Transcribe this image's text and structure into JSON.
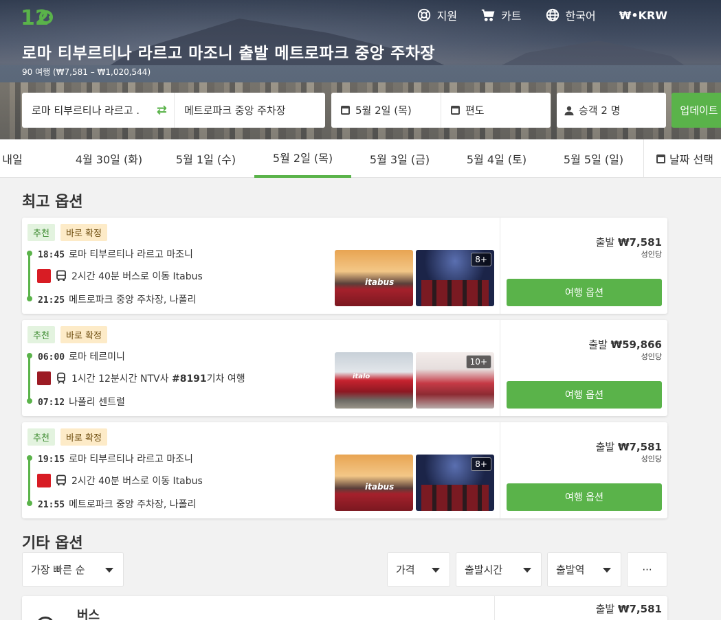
{
  "brand": {
    "logo": "12GO",
    "accent": "#5ab34a"
  },
  "topnav": {
    "support": "지원",
    "cart": "카트",
    "language": "한국어",
    "currency": "₩•KRW"
  },
  "header": {
    "title": "로마 티부르티나 라르고 마조니 출발 메트로파크 중앙 주차장",
    "subtitle": "90 여행 (₩7,581 – ₩1,020,544)"
  },
  "search": {
    "from": "로마 티부르티나 라르고 .",
    "to": "메트로파크 중앙 주차장",
    "date": "5월 2일 (목)",
    "trip_type": "편도",
    "passengers": "승객 2 명",
    "update": "업데이트"
  },
  "dates": {
    "tabs": [
      "내일",
      "4월 30일 (화)",
      "5월 1일 (수)",
      "5월 2일 (목)",
      "5월 3일 (금)",
      "5월 4일 (토)",
      "5월 5일 (일)"
    ],
    "active_index": 3,
    "pick": "날짜 선택"
  },
  "best": {
    "heading": "최고 옵션",
    "trips": [
      {
        "badge_rec": "추천",
        "badge_conf": "바로 확정",
        "dep_time": "18:45",
        "dep_station": "로마 티부르티나 라르고 마조니",
        "duration": "2시간 40분 버스로 이동 Itabus",
        "arr_time": "21:25",
        "arr_station": "메트로파크 중앙 주차장, 나폴리",
        "thumb_brand": "itabus",
        "more": "8+",
        "price": "출발 ₩7,581",
        "per": "성인당",
        "button": "여행 옵션"
      },
      {
        "badge_rec": "추천",
        "badge_conf": "바로 확정",
        "dep_time": "06:00",
        "dep_station": "로마 테르미니",
        "duration_pre": "1시간 12분시간 NTV사 ",
        "duration_num": "#8191",
        "duration_post": "기차 여행",
        "arr_time": "07:12",
        "arr_station": "나폴리 센트럴",
        "thumb_brand": "italo",
        "more": "10+",
        "price": "출발 ₩59,866",
        "per": "성인당",
        "button": "여행 옵션"
      },
      {
        "badge_rec": "추천",
        "badge_conf": "바로 확정",
        "dep_time": "19:15",
        "dep_station": "로마 티부르티나 라르고 마조니",
        "duration": "2시간 40분 버스로 이동 Itabus",
        "arr_time": "21:55",
        "arr_station": "메트로파크 중앙 주차장, 나폴리",
        "thumb_brand": "itabus",
        "more": "8+",
        "price": "출발 ₩7,581",
        "per": "성인당",
        "button": "여행 옵션"
      }
    ]
  },
  "other": {
    "heading": "기타 옵션",
    "sort": "가장 빠른 순",
    "filters": [
      "가격",
      "출발시간",
      "출발역"
    ],
    "more": "···",
    "first_label": "버스",
    "first_price": "출발 ₩7,581"
  }
}
